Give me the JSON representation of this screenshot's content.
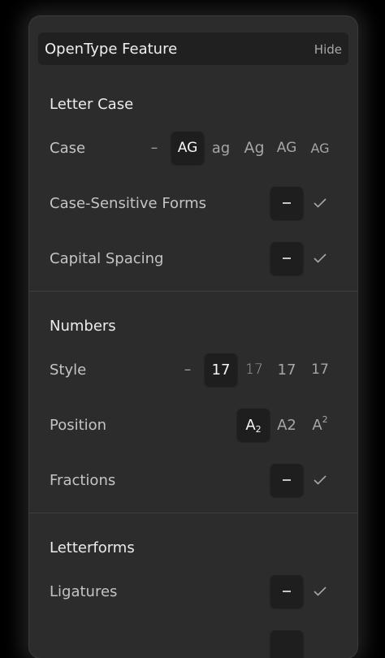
{
  "header": {
    "title": "OpenType Feature",
    "hide": "Hide"
  },
  "letter_case": {
    "title": "Letter Case",
    "case": {
      "label": "Case",
      "options": [
        "–",
        "AG",
        "ag",
        "Ag",
        "AG",
        "AG"
      ],
      "selected": 1
    },
    "case_sensitive": {
      "label": "Case-Sensitive Forms",
      "selected": "off"
    },
    "capital_spacing": {
      "label": "Capital Spacing",
      "selected": "off"
    }
  },
  "numbers": {
    "title": "Numbers",
    "style": {
      "label": "Style",
      "options": [
        "–",
        "17",
        "17",
        "17",
        "17"
      ],
      "selected": 1
    },
    "position": {
      "label": "Position",
      "options": [
        "A",
        "2",
        "A2",
        "A",
        "2"
      ],
      "selected": 0
    },
    "fractions": {
      "label": "Fractions",
      "selected": "off"
    }
  },
  "letterforms": {
    "title": "Letterforms",
    "ligatures": {
      "label": "Ligatures",
      "selected": "off"
    }
  },
  "icons": {
    "off": "dash-icon",
    "on": "checkmark-icon"
  },
  "colors": {
    "panel": "#2c2c2c",
    "header": "#202020",
    "selected": "#1e1e1e"
  }
}
